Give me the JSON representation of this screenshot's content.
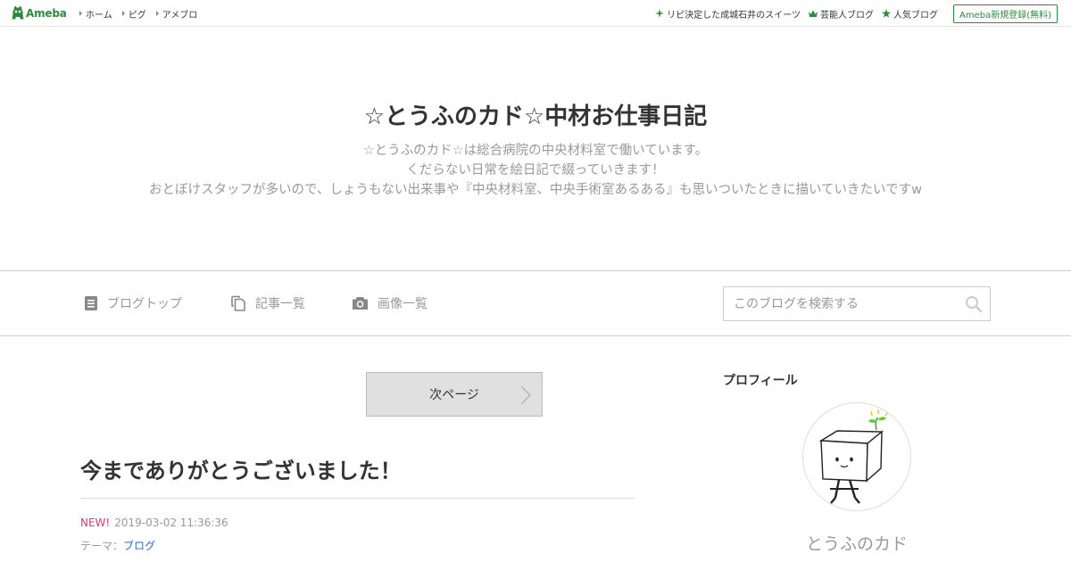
{
  "header": {
    "logo_text": "Ameba",
    "nav": [
      "ホーム",
      "ピグ",
      "アメブロ"
    ],
    "right_links": [
      {
        "label": "リピ決定した成城石井のスイーツ",
        "icon": "sparkle-icon"
      },
      {
        "label": "芸能人ブログ",
        "icon": "crown-icon"
      },
      {
        "label": "人気ブログ",
        "icon": "star-icon"
      }
    ],
    "register_label": "Ameba新規登録(無料)"
  },
  "blog": {
    "title": "☆とうふのカド☆中材お仕事日記",
    "description": [
      "☆とうふのカド☆は総合病院の中央材料室で働いています。",
      "くだらない日常を絵日記で綴っていきます！",
      "おとぼけスタッフが多いので、しょうもない出来事や『中央材料室、中央手術室あるある』も思いついたときに描いていきたいですw"
    ]
  },
  "navbar": {
    "items": [
      {
        "label": "ブログトップ",
        "icon": "document-icon"
      },
      {
        "label": "記事一覧",
        "icon": "copy-icon"
      },
      {
        "label": "画像一覧",
        "icon": "camera-icon"
      }
    ],
    "search_placeholder": "このブログを検索する"
  },
  "main": {
    "next_page_label": "次ページ",
    "entry": {
      "title": "今までありがとうございました！",
      "new_badge": "NEW!",
      "datetime": "2019-03-02 11:36:36",
      "theme_label": "テーマ：",
      "theme_link": "ブログ"
    }
  },
  "sidebar": {
    "profile_heading": "プロフィール",
    "profile_name": "とうふのカド"
  },
  "colors": {
    "brand_green": "#2d8c3c",
    "new_badge": "#e73275",
    "link_blue": "#3366cc",
    "muted_text": "#999999"
  }
}
